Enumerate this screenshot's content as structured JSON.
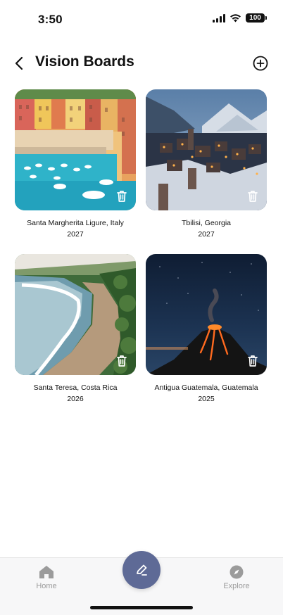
{
  "status_bar": {
    "time": "3:50",
    "battery": "100"
  },
  "header": {
    "title": "Vision Boards"
  },
  "boards": [
    {
      "name": "Santa Margherita Ligure, Italy",
      "year": "2027"
    },
    {
      "name": "Tbilisi, Georgia",
      "year": "2027"
    },
    {
      "name": "Santa Teresa, Costa Rica",
      "year": "2026"
    },
    {
      "name": "Antigua Guatemala, Guatemala",
      "year": "2025"
    }
  ],
  "nav": {
    "home_label": "Home",
    "explore_label": "Explore"
  },
  "colors": {
    "accent": "#5e6a96",
    "nav_inactive": "#9b9b9b"
  }
}
